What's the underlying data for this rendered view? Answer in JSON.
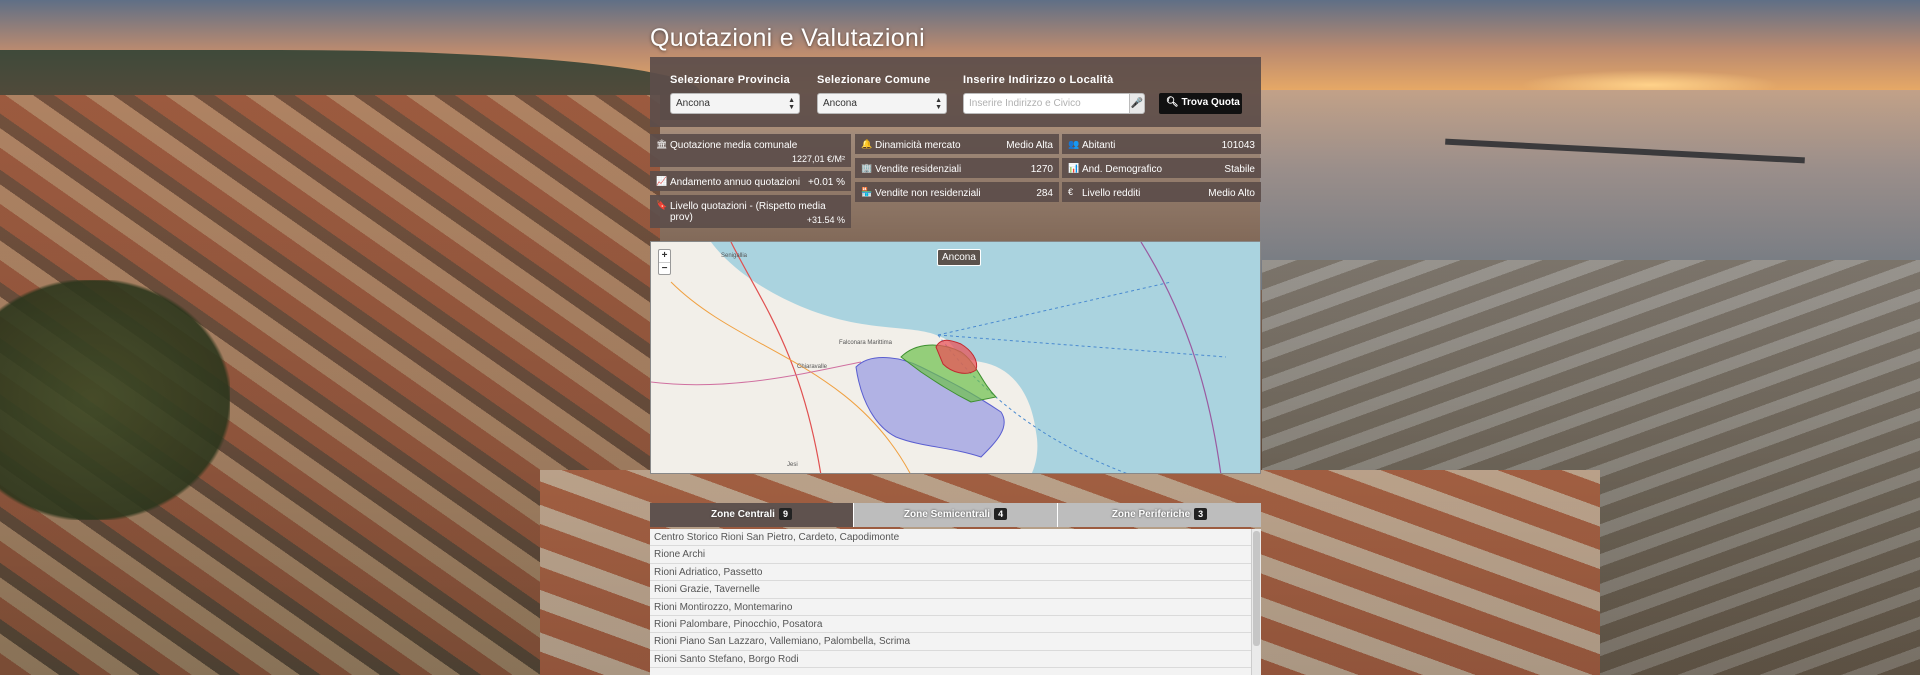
{
  "page": {
    "title": "Quotazioni e Valutazioni"
  },
  "search": {
    "provincia_label": "Selezionare Provincia",
    "provincia_value": "Ancona",
    "comune_label": "Selezionare Comune",
    "comune_value": "Ancona",
    "indirizzo_label": "Inserire Indirizzo o Località",
    "indirizzo_placeholder": "Inserire Indirizzo e Civico",
    "mic_icon": "microphone-icon",
    "find_label": "Trova Quota",
    "find_icon": "search-icon"
  },
  "stats": {
    "col1": [
      {
        "icon": "bank-icon",
        "label": "Quotazione media comunale",
        "value": "1227,01 €/M²"
      },
      {
        "icon": "area-chart-icon",
        "label": "Andamento annuo quotazioni",
        "value": "+0.01 %"
      },
      {
        "icon": "bookmark-icon",
        "label": "Livello quotazioni - (Rispetto media prov)",
        "value": "+31.54 %"
      }
    ],
    "col2": [
      {
        "icon": "bell-icon",
        "label": "Dinamicità mercato",
        "value": "Medio Alta"
      },
      {
        "icon": "building-icon",
        "label": "Vendite residenziali",
        "value": "1270"
      },
      {
        "icon": "shop-icon",
        "label": "Vendite non residenziali",
        "value": "284"
      }
    ],
    "col3": [
      {
        "icon": "users-icon",
        "label": "Abitanti",
        "value": "101043"
      },
      {
        "icon": "bar-chart-icon",
        "label": "And. Demografico",
        "value": "Stabile"
      },
      {
        "icon": "euro-icon",
        "label": "Livello redditi",
        "value": "Medio Alto"
      }
    ]
  },
  "map": {
    "tooltip": "Ancona",
    "zoom_in": "+",
    "zoom_out": "−",
    "labels": [
      "Senigallia",
      "Falconara Marittima",
      "Chiaravalle",
      "Jesi"
    ],
    "colors": {
      "central": "#e8545a",
      "semi": "#6cc04a",
      "peripheral": "#7b7fe0",
      "sea": "#aad3df",
      "land": "#f2efe9"
    }
  },
  "tabs": [
    {
      "label": "Zone Centrali",
      "count": "9",
      "active": true
    },
    {
      "label": "Zone Semicentrali",
      "count": "4",
      "active": false
    },
    {
      "label": "Zone Periferiche",
      "count": "3",
      "active": false
    }
  ],
  "zones": [
    "Centro Storico Rioni San Pietro, Cardeto, Capodimonte",
    "Rione Archi",
    "Rioni Adriatico, Passetto",
    "Rioni Grazie, Tavernelle",
    "Rioni Montirozzo, Montemarino",
    "Rioni Palombare, Pinocchio, Posatora",
    "Rioni Piano San Lazzaro, Vallemiano, Palombella, Scrima",
    "Rioni Santo Stefano, Borgo Rodi"
  ]
}
